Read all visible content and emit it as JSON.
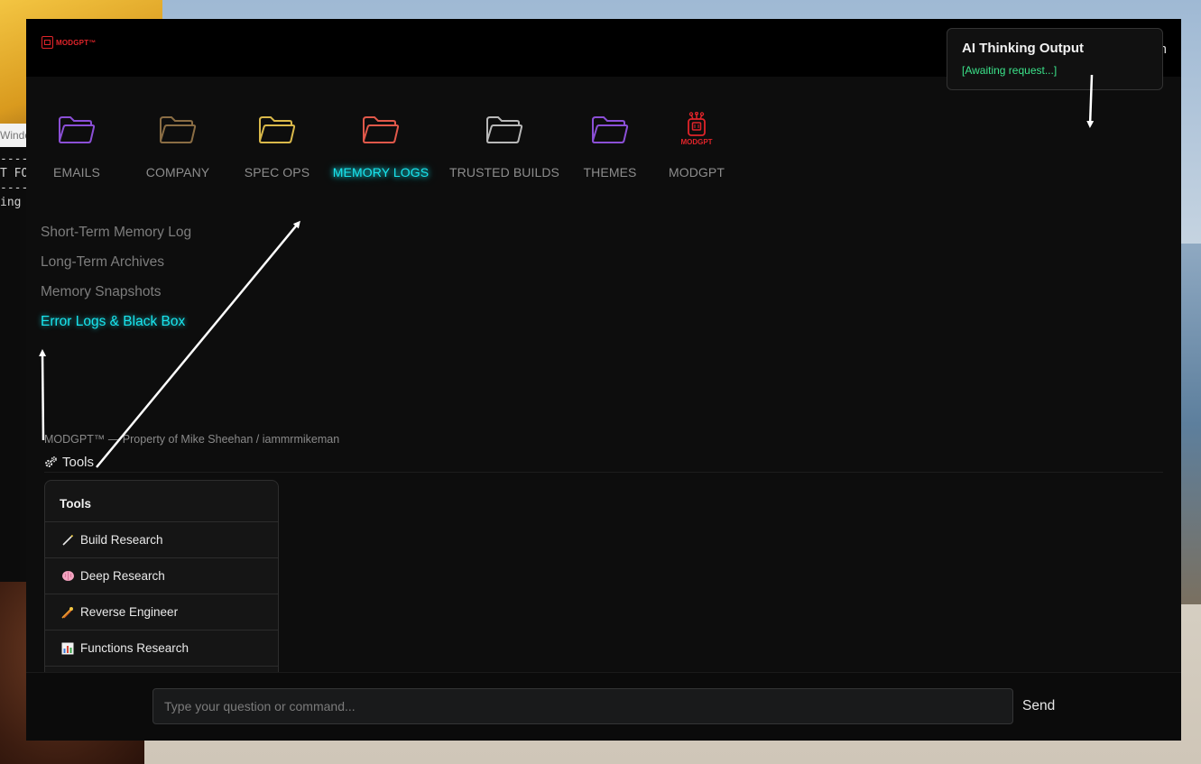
{
  "desktop": {
    "terminal": {
      "title_partial": "Windo",
      "lines": [
        "----",
        "T FO",
        "----",
        "ing"
      ]
    }
  },
  "app": {
    "logo_text": "MODGPT™",
    "topbar_partial_text": "n",
    "nav": [
      {
        "label": "EMAILS",
        "color": "#8b4fd6",
        "icon": "folder-icon"
      },
      {
        "label": "COMPANY",
        "color": "#8a6d44",
        "icon": "folder-icon"
      },
      {
        "label": "SPEC OPS",
        "color": "#d9b84a",
        "icon": "folder-icon"
      },
      {
        "label": "MEMORY LOGS",
        "color": "#e0584a",
        "icon": "folder-icon",
        "active": true
      },
      {
        "label": "TRUSTED BUILDS",
        "color": "#b8b8b8",
        "icon": "folder-icon"
      },
      {
        "label": "THEMES",
        "color": "#8b4fd6",
        "icon": "folder-icon"
      },
      {
        "label": "MODGPT",
        "color": "#e0242a",
        "icon": "robot-chip-icon",
        "icon_text": "MODGPT"
      }
    ],
    "submenu": [
      {
        "label": "Short-Term Memory Log"
      },
      {
        "label": "Long-Term Archives"
      },
      {
        "label": "Memory Snapshots"
      },
      {
        "label": "Error Logs & Black Box",
        "active": true
      }
    ],
    "footer_note": "MODGPT™ — Property of Mike Sheehan / iammrmikeman",
    "tools_toggle_label": "Tools",
    "tools_panel": {
      "title": "Tools",
      "items": [
        {
          "label": "Build Research",
          "icon": "wand-icon"
        },
        {
          "label": "Deep Research",
          "icon": "brain-icon"
        },
        {
          "label": "Reverse Engineer",
          "icon": "comet-icon"
        },
        {
          "label": "Functions Research",
          "icon": "bar-chart-icon"
        }
      ]
    },
    "input": {
      "placeholder": "Type your question or command...",
      "value": "",
      "send_label": "Send"
    },
    "thinking": {
      "title": "AI Thinking Output",
      "status": "[Awaiting request...]"
    },
    "accent_color": "#19e6ef",
    "status_color": "#3be38a"
  }
}
